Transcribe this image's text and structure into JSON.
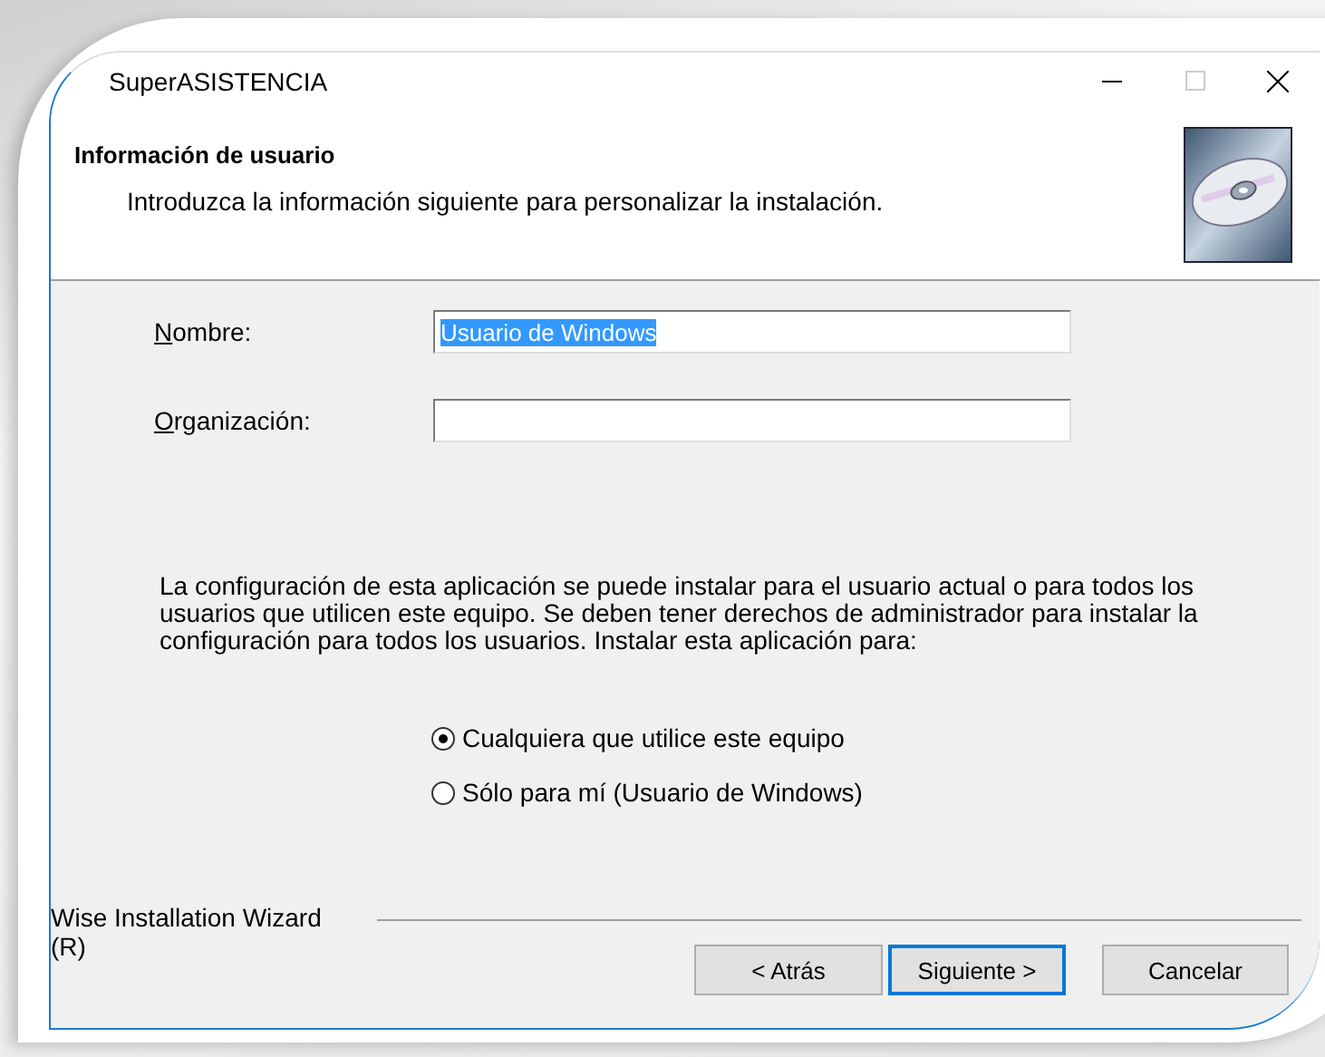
{
  "window": {
    "title": "SuperASISTENCIA",
    "controls": [
      {
        "kind": "minimize"
      },
      {
        "kind": "maximize",
        "disabled": true
      },
      {
        "kind": "close"
      }
    ]
  },
  "header": {
    "title": "Información de usuario",
    "subtitle": "Introduzca la información siguiente para personalizar la instalación."
  },
  "fields": [
    {
      "label": "Nombre:",
      "value": "Usuario de Windows",
      "value_selected": true
    },
    {
      "label": "Organización:"
    }
  ],
  "description": "La configuración de esta aplicación se puede instalar para el usuario actual o para todos los usuarios que utilicen este equipo. Se deben tener derechos de administrador para instalar la configuración para todos los usuarios. Instalar esta aplicación para:",
  "install_for": [
    {
      "label": "Cualquiera que utilice este equipo",
      "selected": true
    },
    {
      "label": "Sólo para mí (Usuario de Windows)",
      "selected": false
    }
  ],
  "footer": {
    "brand": "Wise Installation Wizard (R)"
  },
  "buttons": [
    {
      "label": "< Atrás",
      "default": false
    },
    {
      "label": "Siguiente >",
      "default": true
    },
    {
      "label": "Cancelar",
      "default": false
    }
  ]
}
